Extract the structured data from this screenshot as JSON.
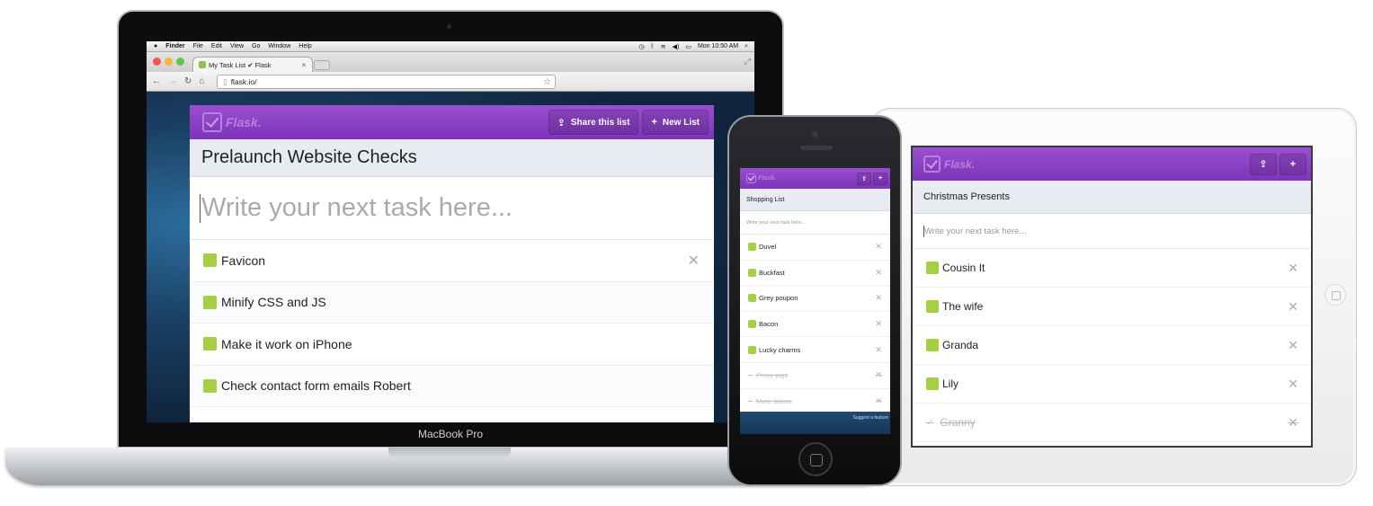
{
  "colors": {
    "brand_purple": "#8a3fc4",
    "checkbox_green": "#a6d043",
    "title_bar_bg": "#e8ebf2"
  },
  "mac": {
    "menubar": {
      "apple": "",
      "items": [
        "Finder",
        "File",
        "Edit",
        "View",
        "Go",
        "Window",
        "Help"
      ],
      "clock": "Mon 10:50 AM"
    },
    "browser": {
      "tab_title": "My Task List ✔ Flask",
      "tab_close": "✕",
      "url": "flask.io/"
    },
    "device_label": "MacBook Pro"
  },
  "laptop_app": {
    "logo": "Flask.",
    "share_label": "Share this list",
    "new_list_label": "New List",
    "list_title": "Prelaunch Website Checks",
    "input_placeholder": "Write your next task here...",
    "tasks": [
      {
        "label": "Favicon",
        "done": false
      },
      {
        "label": "Minify CSS and JS",
        "done": false
      },
      {
        "label": "Make it work on iPhone",
        "done": false
      },
      {
        "label": "Check contact form emails Robert",
        "done": false
      }
    ],
    "delete_glyph": "✕"
  },
  "phone_app": {
    "logo": "Flask.",
    "list_title": "Shopping List",
    "input_placeholder": "Write your next task here...",
    "tasks": [
      {
        "label": "Duvel",
        "done": false
      },
      {
        "label": "Buckfast",
        "done": false
      },
      {
        "label": "Grey poupon",
        "done": false
      },
      {
        "label": "Bacon",
        "done": false
      },
      {
        "label": "Lucky charms",
        "done": false
      },
      {
        "label": "Percy pigs",
        "done": true
      },
      {
        "label": "More bacon",
        "done": true
      }
    ],
    "footer_link": "Suggest a feature"
  },
  "tablet_app": {
    "logo": "Flask.",
    "list_title": "Christmas Presents",
    "input_placeholder": "Write your next task here...",
    "tasks": [
      {
        "label": "Cousin It",
        "done": false
      },
      {
        "label": "The wife",
        "done": false
      },
      {
        "label": "Granda",
        "done": false
      },
      {
        "label": "Lily",
        "done": false
      },
      {
        "label": "Granny",
        "done": true
      }
    ]
  }
}
